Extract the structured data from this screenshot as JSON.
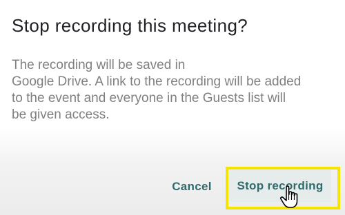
{
  "dialog": {
    "title": "Stop recording this meeting?",
    "body_lines": [
      "The recording will be saved in",
      "Google Drive. A link to the recording will be added",
      "to the event and everyone in the Guests list will",
      "be given access."
    ],
    "cancel_label": "Cancel",
    "confirm_label": "Stop recording"
  },
  "colors": {
    "title": "#202124",
    "body": "#808080",
    "button_text": "#2f6b6b",
    "highlight": "#f5e400"
  },
  "icons": {
    "cursor": "hand-pointer-icon"
  }
}
